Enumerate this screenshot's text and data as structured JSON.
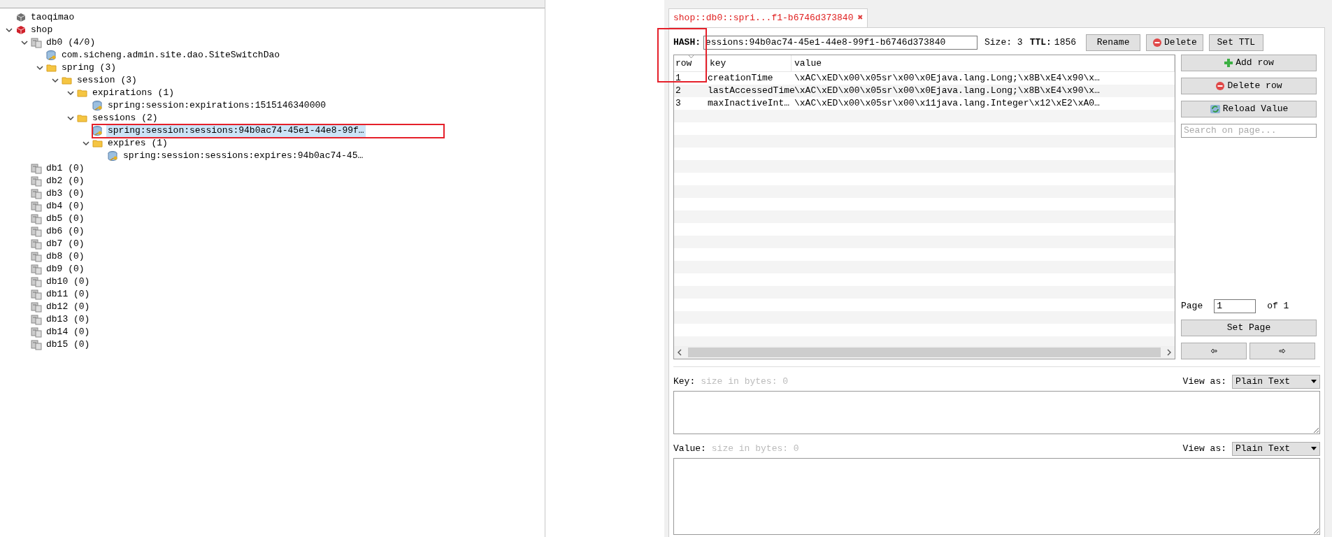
{
  "tree": [
    {
      "label": "taoqimao",
      "kind": "server",
      "color": "#707070"
    },
    {
      "label": "shop",
      "kind": "server",
      "color": "#d0202a",
      "expanded": true,
      "children": [
        {
          "label": "db0  (4/0)",
          "kind": "db",
          "expanded": true,
          "children": [
            {
              "label": "com.sicheng.admin.site.dao.SiteSwitchDao",
              "kind": "key"
            },
            {
              "label": "spring (3)",
              "kind": "folder",
              "expanded": true,
              "children": [
                {
                  "label": "session (3)",
                  "kind": "folder",
                  "expanded": true,
                  "children": [
                    {
                      "label": "expirations (1)",
                      "kind": "folder",
                      "expanded": true,
                      "children": [
                        {
                          "label": "spring:session:expirations:1515146340000",
                          "kind": "key"
                        }
                      ]
                    },
                    {
                      "label": "sessions (2)",
                      "kind": "folder",
                      "expanded": true,
                      "children": [
                        {
                          "label": "spring:session:sessions:94b0ac74-45e1-44e8-99f…",
                          "kind": "key",
                          "selected": true
                        },
                        {
                          "label": "expires (1)",
                          "kind": "folder",
                          "expanded": true,
                          "children": [
                            {
                              "label": "spring:session:sessions:expires:94b0ac74-45…",
                              "kind": "key"
                            }
                          ]
                        }
                      ]
                    }
                  ]
                }
              ]
            }
          ]
        },
        {
          "label": "db1 (0)",
          "kind": "db"
        },
        {
          "label": "db2 (0)",
          "kind": "db"
        },
        {
          "label": "db3 (0)",
          "kind": "db"
        },
        {
          "label": "db4 (0)",
          "kind": "db"
        },
        {
          "label": "db5 (0)",
          "kind": "db"
        },
        {
          "label": "db6 (0)",
          "kind": "db"
        },
        {
          "label": "db7 (0)",
          "kind": "db"
        },
        {
          "label": "db8 (0)",
          "kind": "db"
        },
        {
          "label": "db9 (0)",
          "kind": "db"
        },
        {
          "label": "db10 (0)",
          "kind": "db"
        },
        {
          "label": "db11 (0)",
          "kind": "db"
        },
        {
          "label": "db12 (0)",
          "kind": "db"
        },
        {
          "label": "db13 (0)",
          "kind": "db"
        },
        {
          "label": "db14 (0)",
          "kind": "db"
        },
        {
          "label": "db15 (0)",
          "kind": "db"
        }
      ]
    }
  ],
  "tab": {
    "title": "shop::db0::spri...f1-b6746d373840",
    "close": "✖"
  },
  "key_bar": {
    "type_label": "HASH:",
    "key_name": "essions:94b0ac74-45e1-44e8-99f1-b6746d373840",
    "size_label": "Size:",
    "size": "3",
    "ttl_label": "TTL:",
    "ttl": "1856",
    "buttons": [
      {
        "label": "Rename"
      },
      {
        "label": "Delete"
      },
      {
        "label": "Set TTL"
      }
    ]
  },
  "table": {
    "columns": [
      "row",
      "key",
      "value"
    ],
    "rows": [
      [
        "1",
        "creationTime",
        "\\xAC\\xED\\x00\\x05sr\\x00\\x0Ejava.lang.Long;\\x8B\\xE4\\x90\\x…"
      ],
      [
        "2",
        "lastAccessedTime",
        "\\xAC\\xED\\x00\\x05sr\\x00\\x0Ejava.lang.Long;\\x8B\\xE4\\x90\\x…"
      ],
      [
        "3",
        "maxInactiveInt…",
        "\\xAC\\xED\\x00\\x05sr\\x00\\x11java.lang.Integer\\x12\\xE2\\xA0…"
      ]
    ]
  },
  "side": {
    "buttons": [
      {
        "label": "Add row"
      },
      {
        "label": "Delete row"
      },
      {
        "label": "Reload Value"
      }
    ],
    "search_placeholder": "Search on page...",
    "page_label": "Page",
    "page": "1",
    "of_label": "of 1",
    "set_page": "Set Page"
  },
  "editors": [
    {
      "label": "Key:",
      "hint": "size in bytes: 0",
      "view_label": "View as:",
      "view": "Plain Text"
    },
    {
      "label": "Value:",
      "hint": "size in bytes: 0",
      "view_label": "View as:",
      "view": "Plain Text"
    }
  ]
}
